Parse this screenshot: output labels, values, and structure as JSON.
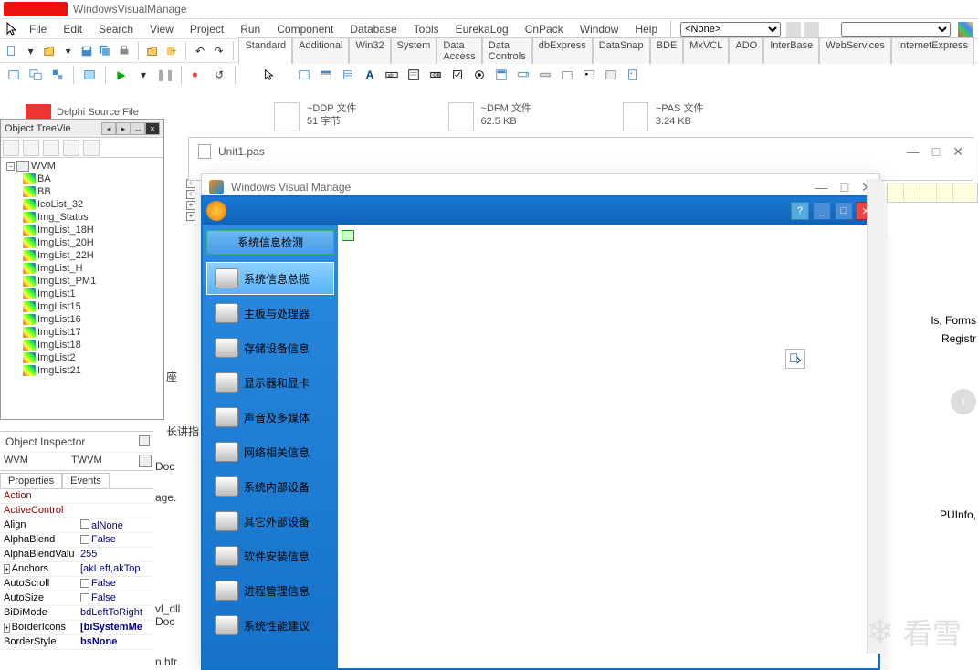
{
  "title": "WindowsVisualManage",
  "menus": [
    "File",
    "Edit",
    "Search",
    "View",
    "Project",
    "Run",
    "Component",
    "Database",
    "Tools",
    "EurekaLog",
    "CnPack",
    "Window",
    "Help"
  ],
  "combo_left": "<None>",
  "combo_right": "",
  "palette_tabs": [
    "Standard",
    "Additional",
    "Win32",
    "System",
    "Data Access",
    "Data Controls",
    "dbExpress",
    "DataSnap",
    "BDE",
    "MxVCL",
    "ADO",
    "InterBase",
    "WebServices",
    "InternetExpress"
  ],
  "files": {
    "src": "Delphi Source File",
    "ddp": {
      "name": "~DDP 文件",
      "size": "51 字节"
    },
    "dfm": {
      "name": "~DFM 文件",
      "size": "62.5 KB"
    },
    "pas": {
      "name": "~PAS 文件",
      "size": "3.24 KB"
    }
  },
  "tree": {
    "title": "Object TreeVie",
    "root": "WVM",
    "items": [
      "BA",
      "BB",
      "IcoList_32",
      "Img_Status",
      "ImgList_18H",
      "ImgList_20H",
      "ImgList_22H",
      "ImgList_H",
      "ImgList_PM1",
      "ImgList1",
      "ImgList15",
      "ImgList16",
      "ImgList17",
      "ImgList18",
      "ImgList2",
      "ImgList21"
    ]
  },
  "cropped": {
    "c1": "座",
    "c2": "长讲指",
    "c3": "Doc",
    "c4": "age.",
    "c5": "vl_dll",
    "c6": "Doc",
    "c7": "n.htr"
  },
  "inspector": {
    "title": "Object Inspector",
    "obj_name": "WVM",
    "obj_type": "TWVM",
    "tabs": [
      "Properties",
      "Events"
    ],
    "props": [
      {
        "n": "Action",
        "v": "",
        "red": true
      },
      {
        "n": "ActiveControl",
        "v": "",
        "red": true
      },
      {
        "n": "Align",
        "v": "alNone",
        "red": false,
        "icon": true
      },
      {
        "n": "AlphaBlend",
        "v": "False",
        "red": false,
        "chk": true
      },
      {
        "n": "AlphaBlendValu",
        "v": "255",
        "red": false
      },
      {
        "n": "Anchors",
        "v": "[akLeft,akTop",
        "red": false,
        "exp": true
      },
      {
        "n": "AutoScroll",
        "v": "False",
        "red": false,
        "chk": true
      },
      {
        "n": "AutoSize",
        "v": "False",
        "red": false,
        "chk": true
      },
      {
        "n": "BiDiMode",
        "v": "bdLeftToRight",
        "red": false
      },
      {
        "n": "BorderIcons",
        "v": "[biSystemMe",
        "red": false,
        "exp": true,
        "bold": true
      },
      {
        "n": "BorderStyle",
        "v": "bsNone",
        "red": false,
        "bold": true
      }
    ]
  },
  "unit_window": "Unit1.pas",
  "app_window": "Windows Visual Manage",
  "running": {
    "header": "系统信息检测",
    "items": [
      {
        "label": "系统信息总揽",
        "sel": true
      },
      {
        "label": "主板与处理器"
      },
      {
        "label": "存储设备信息"
      },
      {
        "label": "显示器和显卡"
      },
      {
        "label": "声音及多媒体"
      },
      {
        "label": "网络相关信息"
      },
      {
        "label": "系统内部设备"
      },
      {
        "label": "其它外部设备"
      },
      {
        "label": "软件安装信息"
      },
      {
        "label": "进程管理信息"
      },
      {
        "label": "系统性能建议"
      }
    ]
  },
  "far_code": {
    "l1": "ls, Forms",
    "l2": "Registr",
    "l3": "PUInfo,"
  },
  "watermark": "看雪"
}
